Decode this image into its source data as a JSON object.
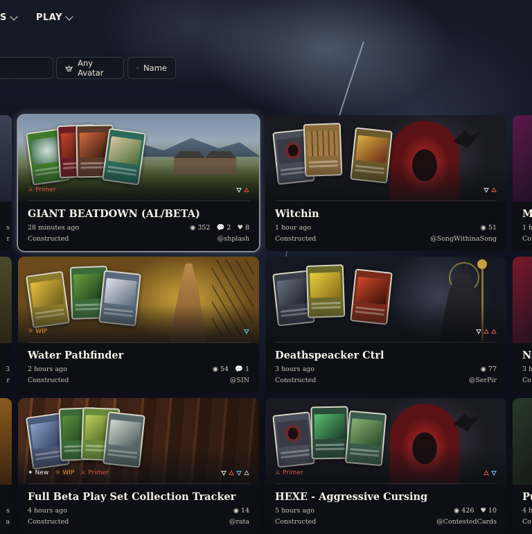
{
  "nav": {
    "cut_item_label": "s",
    "play_label": "Play"
  },
  "filters": {
    "avatar_label": "Any Avatar",
    "sort_label": "Name"
  },
  "decks": [
    {
      "title": "GIANT BEATDOWN (AL/BETA)",
      "time": "28 minutes ago",
      "format": "Constructed",
      "author": "@shplash",
      "views": "352",
      "comments": "2",
      "likes": "8",
      "badges": [
        "Primer"
      ],
      "elements": [
        "air",
        "fire"
      ]
    },
    {
      "title": "Witchin",
      "time": "1 hour ago",
      "format": "Constructed",
      "author": "@SongWithinaSong",
      "views": "51",
      "badges": [],
      "elements": [
        "air",
        "fire"
      ]
    },
    {
      "title": "Water Pathfinder",
      "time": "2 hours ago",
      "format": "Constructed",
      "author": "@SIN",
      "views": "54",
      "comments": "1",
      "badges": [
        "WIP"
      ],
      "elements": [
        "water"
      ]
    },
    {
      "title": "Deathspeacker Ctrl",
      "time": "3 hours ago",
      "format": "Constructed",
      "author": "@SerPir",
      "views": "77",
      "badges": [],
      "elements": [
        "air",
        "fire",
        "fire"
      ]
    },
    {
      "title": "Full Beta Play Set Collection Tracker",
      "time": "4 hours ago",
      "format": "Constructed",
      "author": "@rata",
      "views": "14",
      "badges": [
        "New",
        "WIP",
        "Primer"
      ],
      "elements": [
        "air",
        "fire",
        "water",
        "earth"
      ]
    },
    {
      "title": "HEXE - Aggressive Cursing",
      "time": "5 hours ago",
      "format": "Constructed",
      "author": "@ContestedCards",
      "views": "426",
      "likes": "10",
      "badges": [
        "Primer"
      ],
      "elements": [
        "fire",
        "water"
      ]
    }
  ],
  "edge_left": {
    "row1": [
      "s",
      "r"
    ],
    "row2": [
      "3",
      "r"
    ],
    "row3": [
      "s",
      "a"
    ]
  },
  "edge_right": {
    "row1": {
      "title": "M",
      "time": "1 h",
      "format": "Co"
    },
    "row2": {
      "title": "Ne",
      "time": "3 h",
      "format": "Co"
    },
    "row3": {
      "title": "Pu",
      "time": "4 h",
      "format": "Co"
    }
  },
  "colors": {
    "primer": "#e0533f",
    "wip": "#e79a35",
    "air": "#e8e8e8",
    "fire": "#e0533f",
    "water": "#6ec8e8",
    "earth": "#b9b9b9"
  }
}
